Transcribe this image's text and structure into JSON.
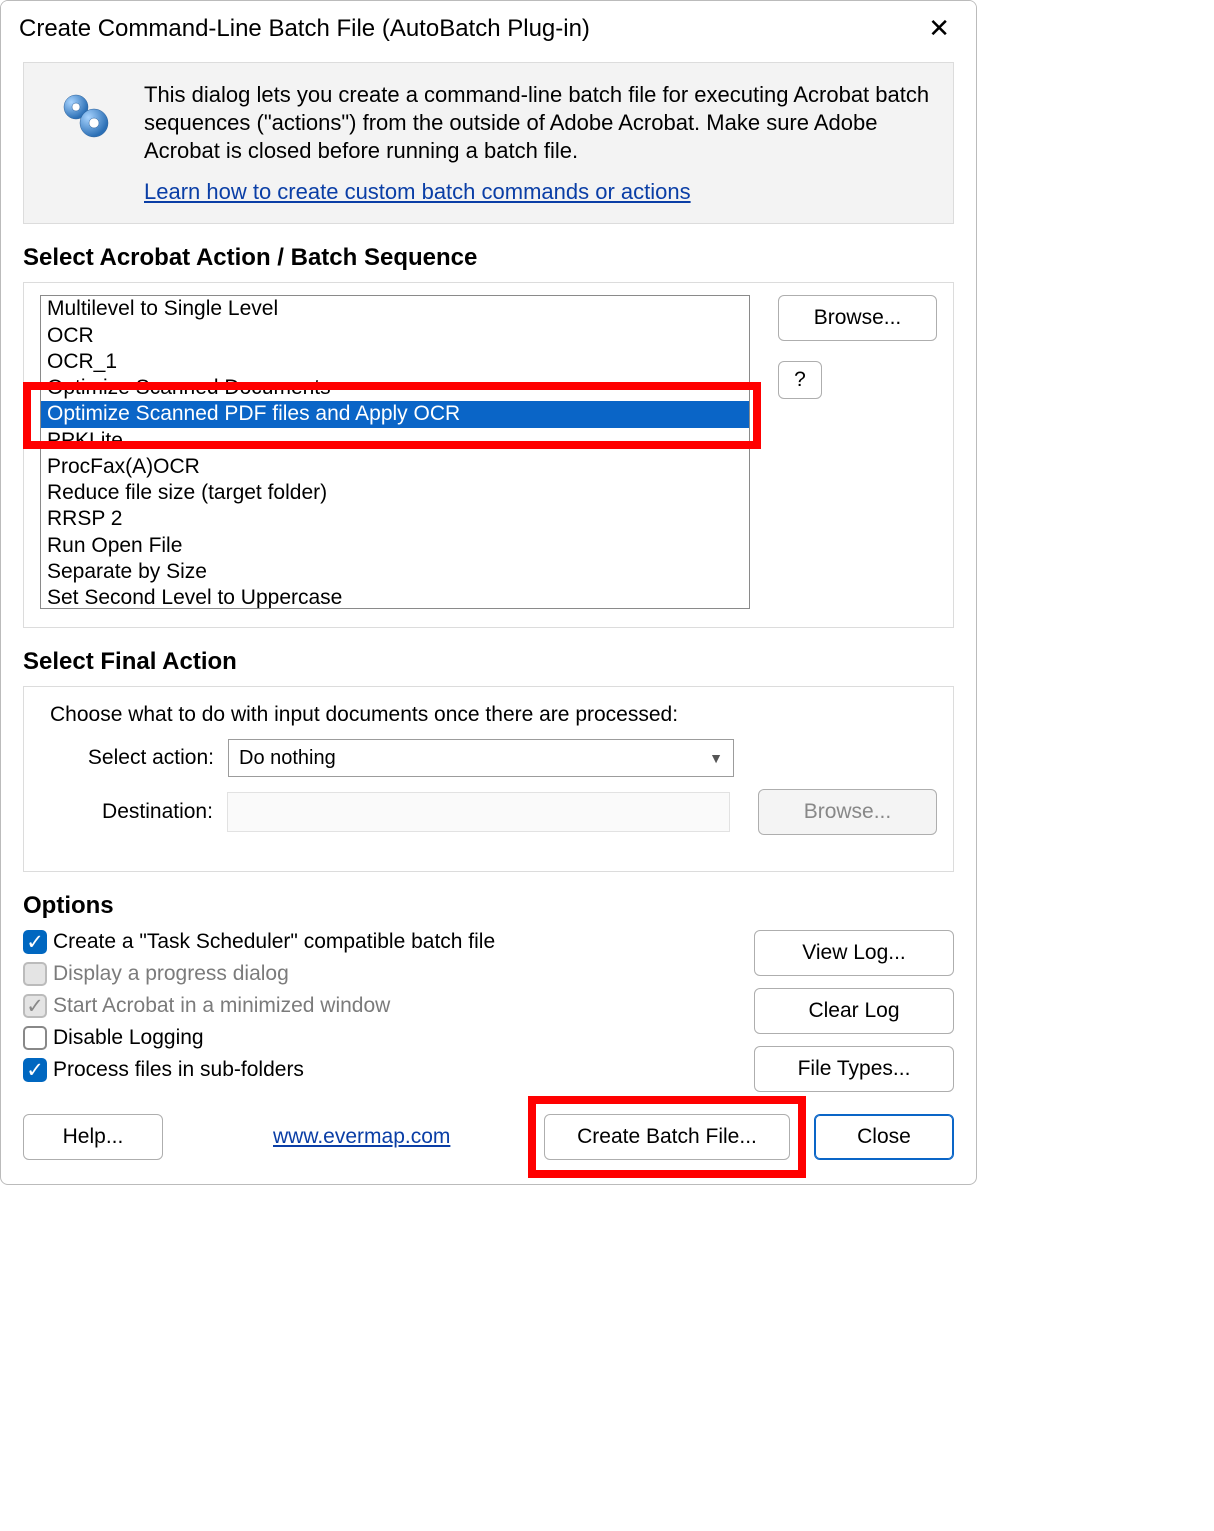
{
  "title": "Create Command-Line Batch File (AutoBatch Plug-in)",
  "intro": {
    "text": "This dialog lets you create a command-line batch file for executing Acrobat batch sequences (\"actions\") from the outside of Adobe Acrobat. Make sure Adobe Acrobat is closed before running a batch file.",
    "link": "Learn how to create custom batch commands or actions"
  },
  "select_sequence_header": "Select Acrobat Action / Batch Sequence",
  "list_items": [
    "Multilevel to Single Level",
    "OCR",
    "OCR_1",
    "Optimize Scanned Documents",
    "Optimize Scanned PDF files and Apply OCR",
    "PPKLite",
    "ProcFax(A)OCR",
    "Reduce file size (target folder)",
    "RRSP 2",
    "Run Open File",
    "Separate by Size",
    "Set Second Level to Uppercase"
  ],
  "selected_index": 4,
  "browse_label": "Browse...",
  "help_q": "?",
  "final_header": "Select Final Action",
  "final_prompt": "Choose what to do with input documents once there are processed:",
  "select_action_label": "Select action:",
  "select_action_value": "Do nothing",
  "destination_label": "Destination:",
  "browse2_label": "Browse...",
  "options_header": "Options",
  "checks": {
    "task_scheduler": "Create a \"Task Scheduler\" compatible batch file",
    "progress_dialog": "Display a progress dialog",
    "minimized": "Start Acrobat in a minimized window",
    "disable_logging": "Disable Logging",
    "subfolders": "Process files in sub-folders"
  },
  "opt_buttons": {
    "view_log": "View Log...",
    "clear_log": "Clear Log",
    "file_types": "File Types..."
  },
  "footer": {
    "help": "Help...",
    "url": "www.evermap.com",
    "create": "Create Batch File...",
    "close": "Close"
  }
}
